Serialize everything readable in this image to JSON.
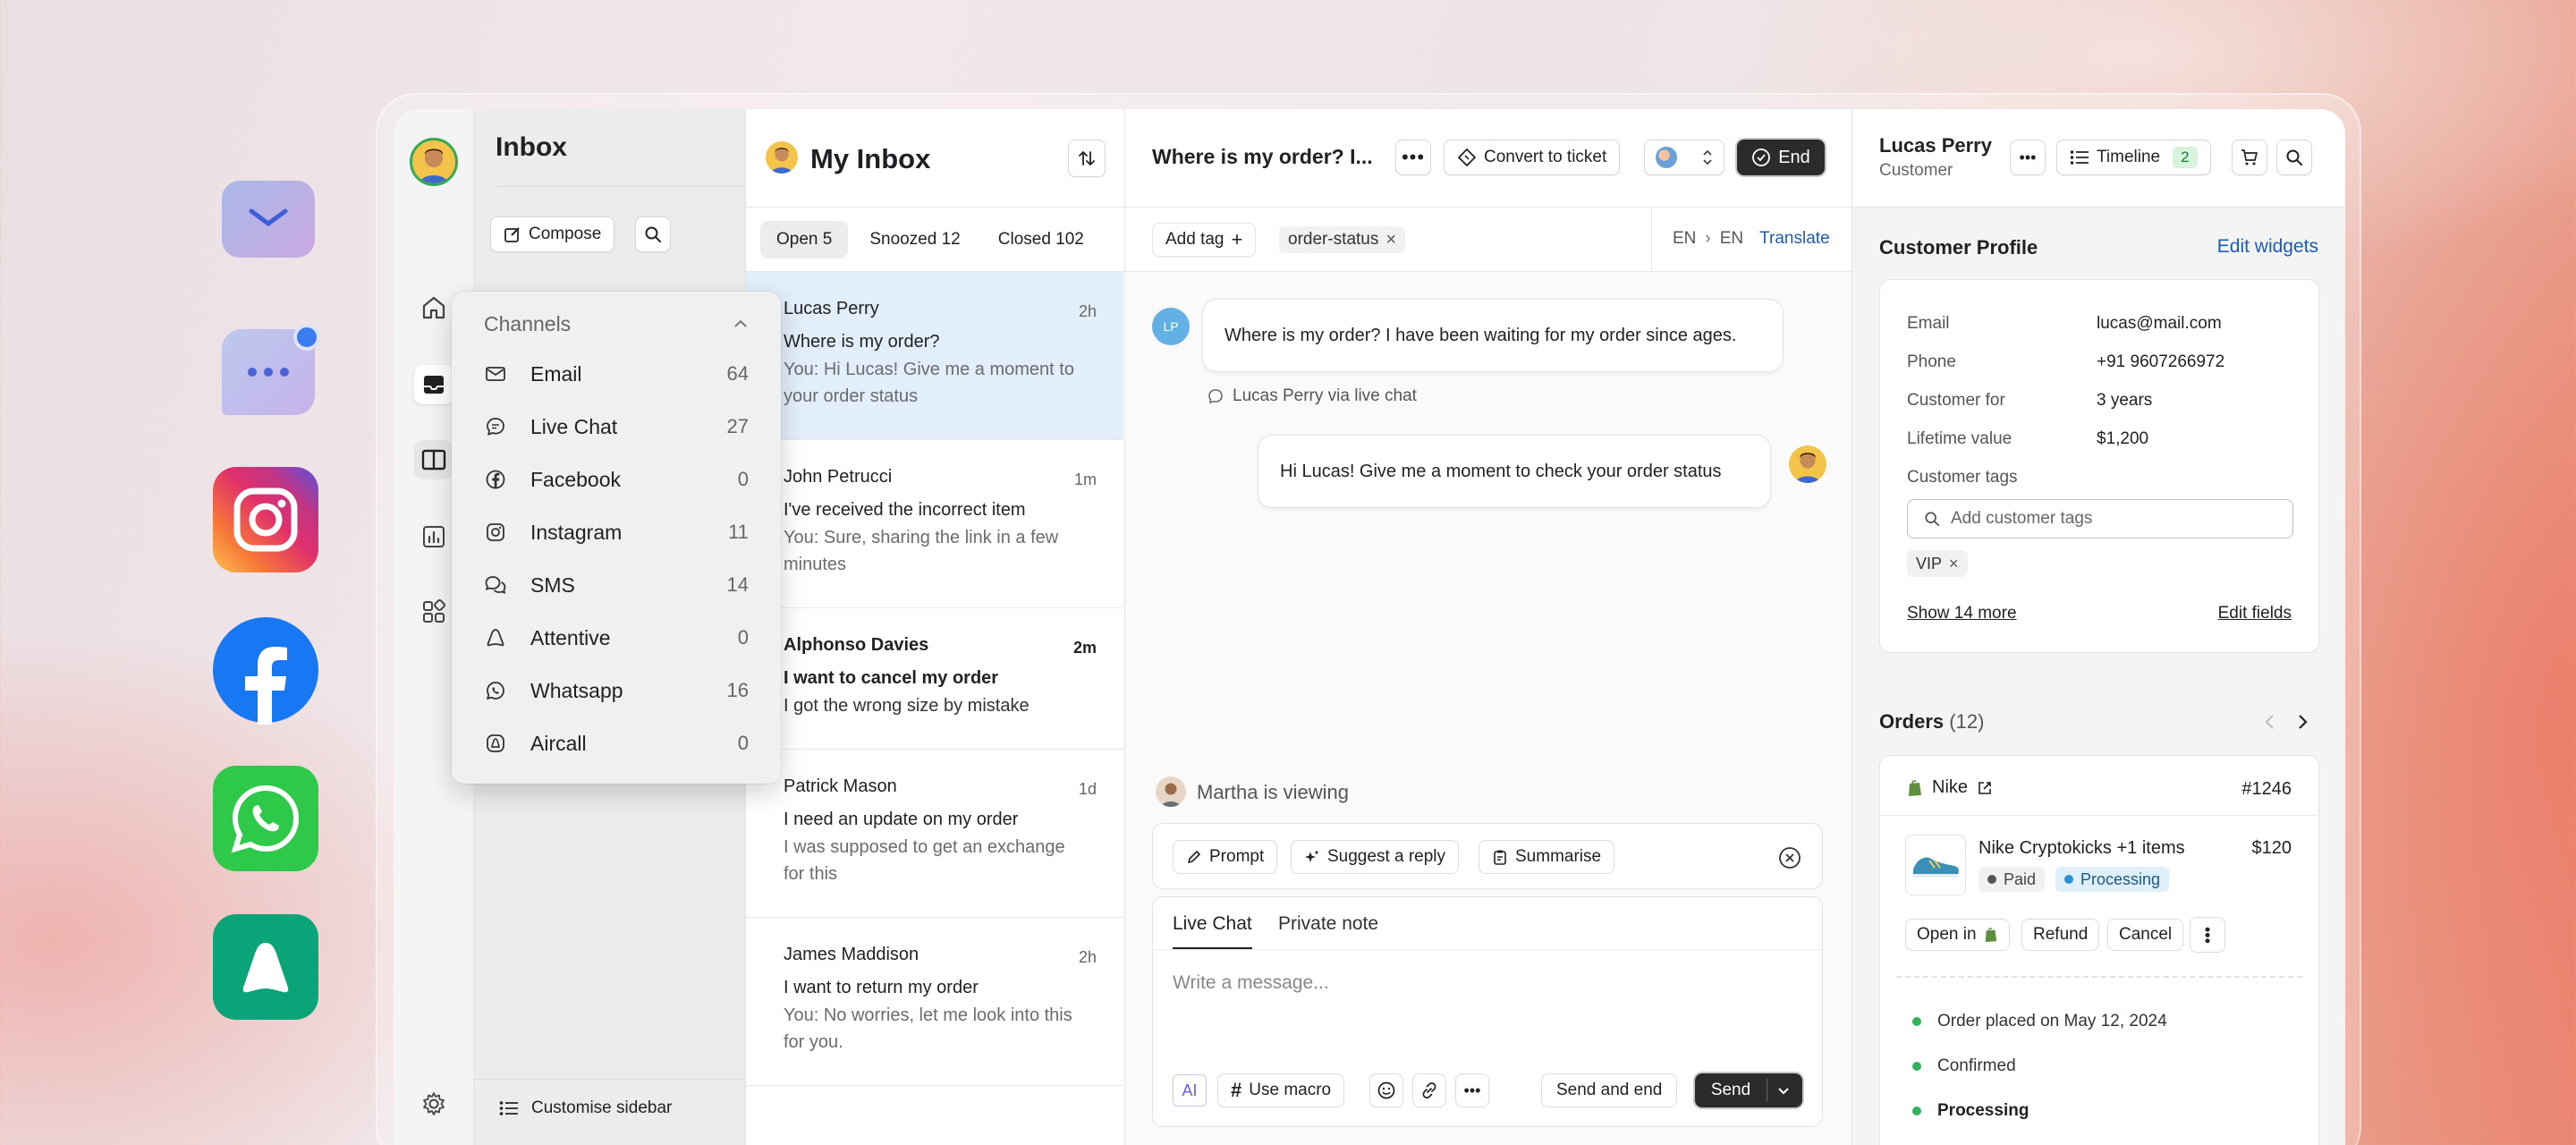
{
  "sidebar": {
    "title": "Inbox",
    "compose_label": "Compose",
    "customise_label": "Customise sidebar"
  },
  "channels": {
    "header": "Channels",
    "items": [
      {
        "label": "Email",
        "count": "64",
        "icon": "mail-icon"
      },
      {
        "label": "Live Chat",
        "count": "27",
        "icon": "chat-bubble-icon"
      },
      {
        "label": "Facebook",
        "count": "0",
        "icon": "facebook-icon"
      },
      {
        "label": "Instagram",
        "count": "11",
        "icon": "instagram-icon"
      },
      {
        "label": "SMS",
        "count": "14",
        "icon": "sms-icon"
      },
      {
        "label": "Attentive",
        "count": "0",
        "icon": "attentive-icon"
      },
      {
        "label": "Whatsapp",
        "count": "16",
        "icon": "whatsapp-icon"
      },
      {
        "label": "Aircall",
        "count": "0",
        "icon": "aircall-icon"
      }
    ]
  },
  "inbox": {
    "title": "My Inbox",
    "tabs": [
      "Open 5",
      "Snoozed 12",
      "Closed 102"
    ],
    "conversations": [
      {
        "name": "Lucas Perry",
        "time": "2h",
        "subject": "Where is my order?",
        "preview": [
          "You: Hi Lucas! Give me  a moment to",
          "your order status"
        ]
      },
      {
        "name": "John Petrucci",
        "time": "1m",
        "subject": "I've received the incorrect item",
        "preview": [
          "You: Sure, sharing the link in a few",
          "minutes"
        ]
      },
      {
        "name": "Alphonso Davies",
        "time": "2m",
        "subject": "I want to cancel my order",
        "preview": [
          "I got the wrong size by mistake"
        ]
      },
      {
        "name": "Patrick Mason",
        "time": "1d",
        "subject": "I need an update on my order",
        "preview": [
          "I was supposed to get an exchange",
          "for this"
        ]
      },
      {
        "name": "James Maddison",
        "time": "2h",
        "subject": "I want to return my order",
        "preview": [
          "You: No worries, let me look into this",
          "for you."
        ]
      }
    ]
  },
  "chat": {
    "title": "Where is my order? I...",
    "convert_label": "Convert to ticket",
    "end_label": "End",
    "add_tag_label": "Add tag",
    "tag": "order-status",
    "lang_from": "EN",
    "lang_to": "EN",
    "translate_label": "Translate",
    "customer_initials": "LP",
    "customer_message": "Where is my order? I have been waiting for my order since ages.",
    "via_label": "Lucas Perry via live chat",
    "agent_message": "Hi Lucas! Give me  a moment to check your order status",
    "viewing_label": "Martha is viewing",
    "ai_buttons": [
      "Prompt",
      "Suggest a reply",
      "Summarise"
    ],
    "compose_tabs": [
      "Live Chat",
      "Private note"
    ],
    "placeholder": "Write a message...",
    "ai_label": "AI",
    "macro_label": "Use macro",
    "send_end_label": "Send and end",
    "send_label": "Send"
  },
  "customer": {
    "name": "Lucas Perry",
    "role": "Customer",
    "timeline_label": "Timeline",
    "timeline_count": "2",
    "profile_title": "Customer Profile",
    "edit_widgets": "Edit widgets",
    "fields": [
      {
        "label": "Email",
        "value": "lucas@mail.com"
      },
      {
        "label": "Phone",
        "value": "+91 9607266972"
      },
      {
        "label": "Customer for",
        "value": "3 years"
      },
      {
        "label": "Lifetime value",
        "value": "$1,200"
      }
    ],
    "tags_label": "Customer tags",
    "tags_placeholder": "Add customer tags",
    "tag": "VIP",
    "show_more": "Show 14 more",
    "edit_fields": "Edit fields"
  },
  "orders": {
    "title": "Orders",
    "count": "(12)",
    "store": "Nike",
    "number": "#1246",
    "product": "Nike Cryptokicks +1 items",
    "price": "$120",
    "paid": "Paid",
    "status": "Processing",
    "open_label": "Open in",
    "refund_label": "Refund",
    "cancel_label": "Cancel",
    "timeline": [
      "Order placed on May 12, 2024",
      "Confirmed",
      "Processing"
    ]
  },
  "colors": {
    "accent": "#1e5bb8",
    "selected_row": "#e3eefb",
    "dark_button": "#2b2b2e",
    "status_green": "#33b35a"
  }
}
